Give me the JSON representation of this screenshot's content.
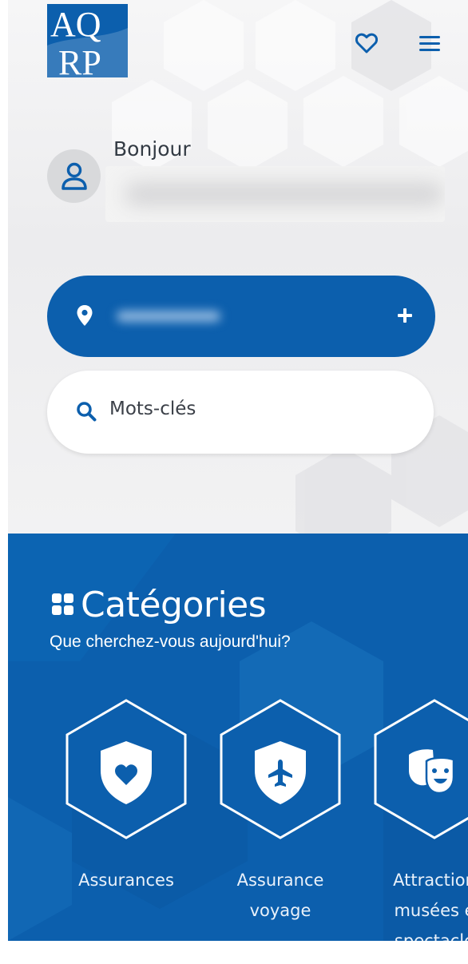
{
  "header": {
    "logo_text": "AQRP",
    "favorites_icon": "heart-outline-icon",
    "menu_icon": "hamburger-menu-icon"
  },
  "greeting": {
    "label": "Bonjour",
    "avatar_icon": "user-icon"
  },
  "location": {
    "icon": "map-pin-icon",
    "action_icon": "plus-icon"
  },
  "search": {
    "placeholder": "Mots-clés",
    "icon": "search-icon"
  },
  "categories": {
    "title": "Catégories",
    "subtitle": "Que cherchez-vous aujourd'hui?",
    "icon": "grid-icon",
    "items": [
      {
        "label_line1": "Assurances",
        "label_line2": "",
        "label_line3": "",
        "icon": "shield-heart-icon"
      },
      {
        "label_line1": "Assurance",
        "label_line2": "voyage",
        "label_line3": "",
        "icon": "shield-plane-icon"
      },
      {
        "label_line1": "Attraction",
        "label_line2": "musées e",
        "label_line3": "spectacle",
        "icon": "theater-masks-icon"
      }
    ]
  },
  "colors": {
    "primary": "#0c5fad",
    "text_dark": "#333b44",
    "avatar_bg": "#d8d9db"
  }
}
